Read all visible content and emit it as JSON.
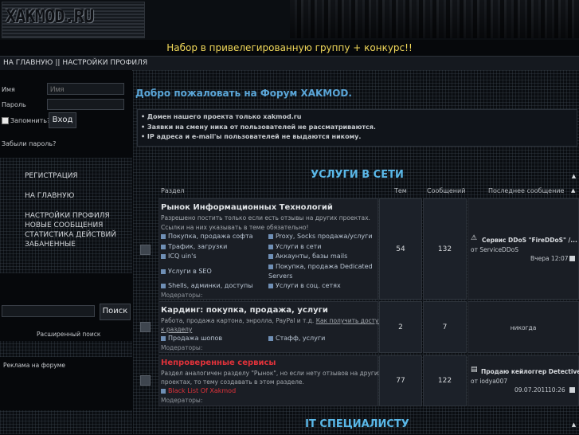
{
  "header": {
    "logo_text": "XAKMOD.RU",
    "recruit": "Набор в привелегированную группу + конкурс!!"
  },
  "topnav": {
    "items": [
      "НА ГЛАВНУЮ",
      "||",
      "НАСТРОЙКИ ПРОФИЛЯ"
    ]
  },
  "login": {
    "username_label": "Имя",
    "username_placeholder": "Имя",
    "password_label": "Пароль",
    "remember_label": "Запомнить?",
    "login_button": "Вход",
    "forgot": "Забыли пароль?"
  },
  "sidebar_menu": {
    "register": "РЕГИСТРАЦИЯ",
    "home": "НА ГЛАВНУЮ",
    "profile": "НАСТРОЙКИ ПРОФИЛЯ",
    "new_posts": "НОВЫЕ СООБЩЕНИЯ",
    "stats": "СТАТИСТИКА ДЕЙСТВИЙ",
    "banned": "ЗАБАНЕННЫЕ"
  },
  "search": {
    "button": "Поиск",
    "advanced": "Расширенный поиск"
  },
  "ads": {
    "label": "Реклама на форуме"
  },
  "welcome": "Добро пожаловать на Форум XAKMOD.",
  "notices": [
    "• Домен нашего проекта только xakmod.ru",
    "• Заявки на смену ника от пользователей не рассматриваются.",
    "• IP адреса и e-mail'ы пользователей не выдаются никому."
  ],
  "categories": {
    "services": "УСЛУГИ В СЕТИ",
    "it": "IT СПЕЦИАЛИСТУ"
  },
  "columns": {
    "section": "Раздел",
    "topics": "Тем",
    "posts": "Сообщений",
    "last": "Последнее сообщение"
  },
  "forums": [
    {
      "title": "Рынок Информационных Технологий",
      "desc1": "Разрешено постить только если есть отзывы на других проектах.",
      "desc2": "Ссылки на них указывать в теме обязательно!",
      "subs": [
        "Покупка, продажа софта",
        "Proxy, Socks продажа/услуги",
        "Трафик, загрузки",
        "Услуги в сети",
        "ICQ uin's",
        "Аккаунты, базы mails",
        "Услуги в SEO",
        "Покупка, продажа Dedicated",
        "Servers",
        "Shells, админки, доступы",
        "Услуги в соц. сетях"
      ],
      "mods": "Модераторы:",
      "topics": "54",
      "posts": "132",
      "last_title": "Сервис DDoS \"FireDDoS\" /...",
      "last_by": "от ServiceDDoS",
      "last_time": "Вчера 12:07"
    },
    {
      "title": "Кардинг: покупка, продажа, услуги",
      "desc1": "Работа, продажа картона, энролла, PayPal и т.д.",
      "desc_link": "Как получить доступ",
      "desc2": "к разделу",
      "subs": [
        "Продажа шопов",
        "Стафф, услуги"
      ],
      "mods": "Модераторы:",
      "topics": "2",
      "posts": "7",
      "last_text": "никогда"
    },
    {
      "title": "Непроверенные сервисы",
      "desc1": "Раздел аналогичен разделу \"Рынок\", но если нету отзывов на других",
      "desc2": "проектах, то тему создавать в этом разделе.",
      "subs": [
        "Black List Of Xakmod"
      ],
      "mods": "Модераторы:",
      "topics": "77",
      "posts": "122",
      "last_title": "Продаю кейлоггер Detective",
      "last_by": "от iodya007",
      "last_time": "09.07.2011",
      "last_clock": "10:26"
    }
  ],
  "colors": {
    "accent": "#5ab8e8",
    "recruit": "#f2d95a",
    "red": "#e0323a"
  }
}
